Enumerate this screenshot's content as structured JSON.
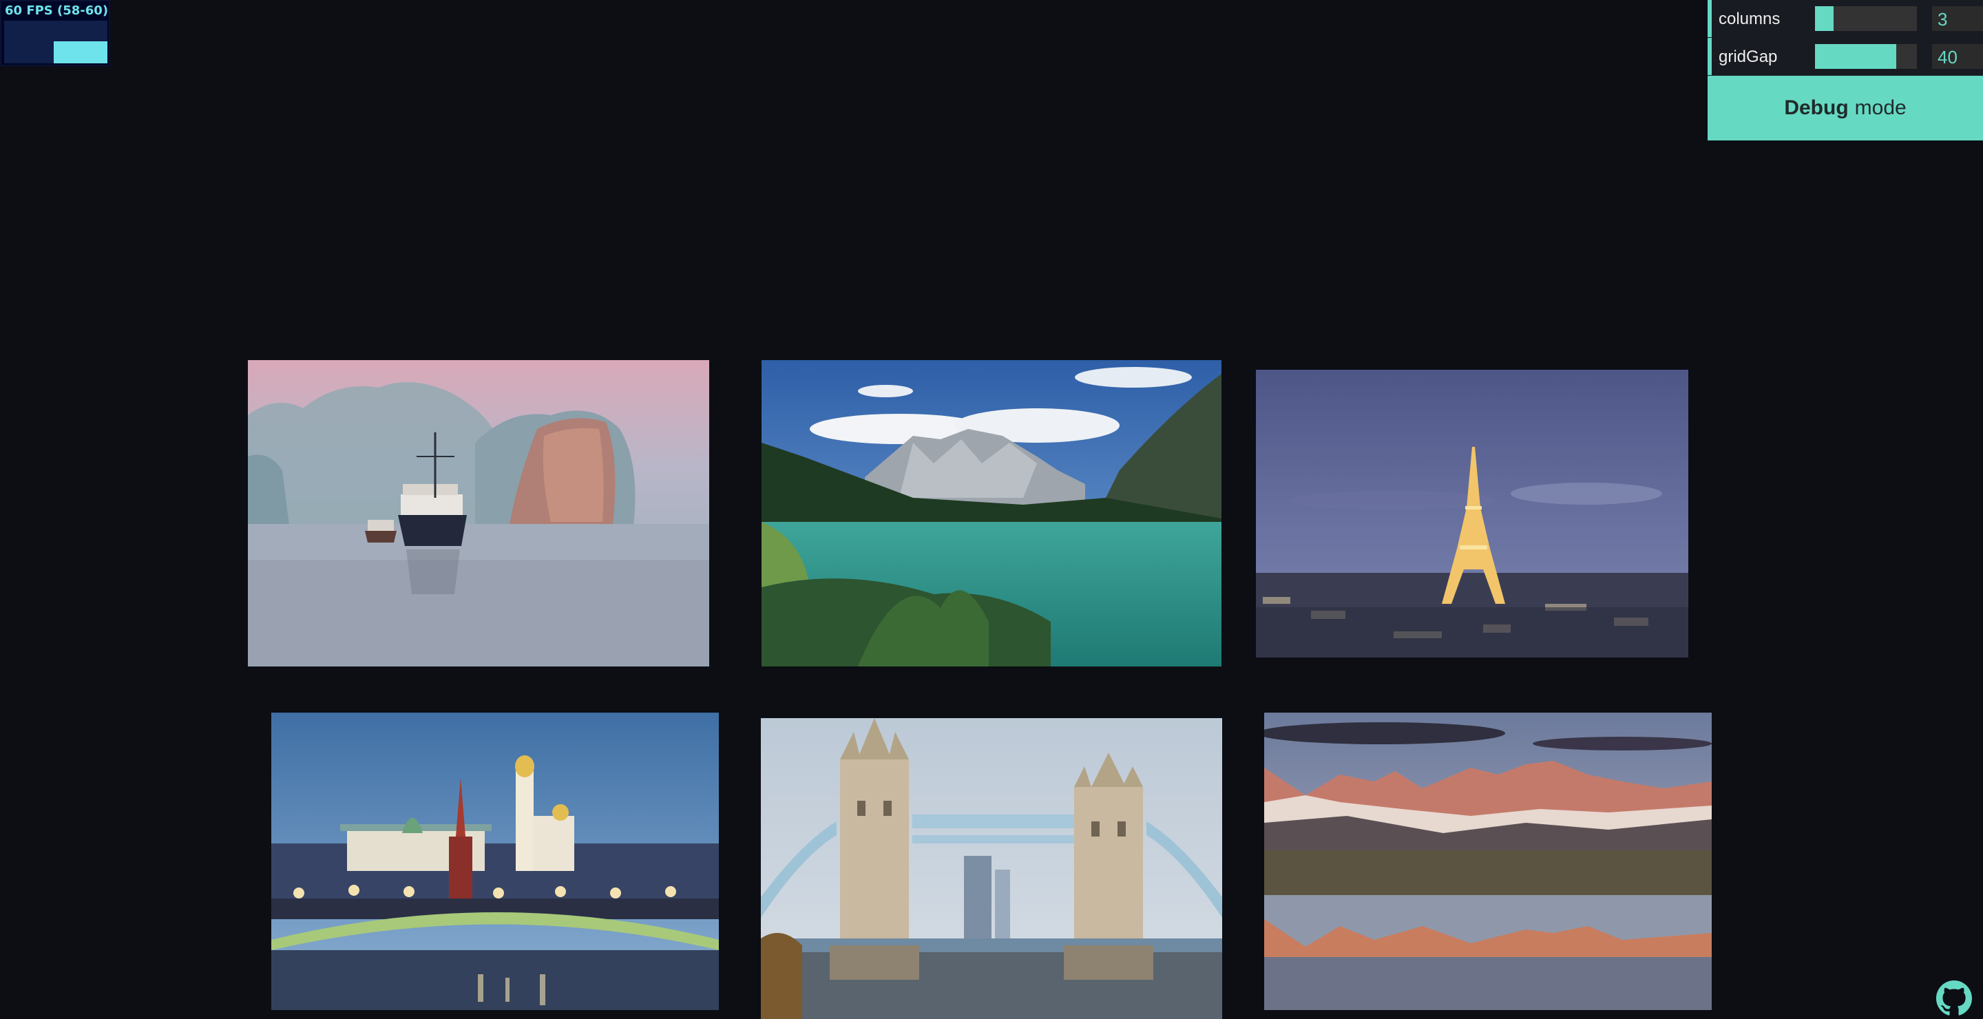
{
  "fps_meter": {
    "label": "60 FPS (58-60)",
    "fps": 60,
    "level": 1.0
  },
  "controls": {
    "columns": {
      "label": "columns",
      "value": "3",
      "fill_fraction": 0.18
    },
    "gridGap": {
      "label": "gridGap",
      "value": "40",
      "fill_fraction": 0.8
    },
    "debug_button": {
      "bold": "Debug",
      "rest": "mode"
    }
  },
  "gallery": {
    "photos": [
      {
        "name": "ha-long-bay-boat"
      },
      {
        "name": "alpine-lake-mountains"
      },
      {
        "name": "eiffel-tower-night"
      },
      {
        "name": "moscow-kremlin-bridge"
      },
      {
        "name": "tower-bridge-london"
      },
      {
        "name": "mountain-lake-reflection-sunset"
      }
    ]
  },
  "icons": {
    "github": "github-icon"
  },
  "colors": {
    "background": "#0c0e14",
    "accent": "#66d9c3",
    "fps_accent": "#6fe3ec"
  }
}
